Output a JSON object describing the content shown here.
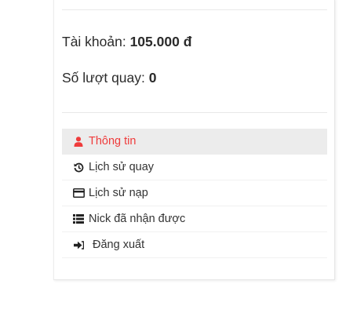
{
  "account": {
    "balance_label": "Tài khoản: ",
    "balance_value": "105.000 đ",
    "spins_label": "Số lượt quay: ",
    "spins_value": "0"
  },
  "menu": {
    "items": [
      {
        "label": "Thông tin",
        "icon": "user-icon",
        "active": true
      },
      {
        "label": "Lịch sử quay",
        "icon": "history-icon",
        "active": false
      },
      {
        "label": "Lịch sử nạp",
        "icon": "credit-card-icon",
        "active": false
      },
      {
        "label": "Nick đã nhận được",
        "icon": "list-icon",
        "active": false
      },
      {
        "label": "Đăng xuất",
        "icon": "sign-out-icon",
        "active": false
      }
    ]
  },
  "colors": {
    "accent": "#ef3b3b",
    "active_bg": "#ececec",
    "text": "#333333"
  }
}
